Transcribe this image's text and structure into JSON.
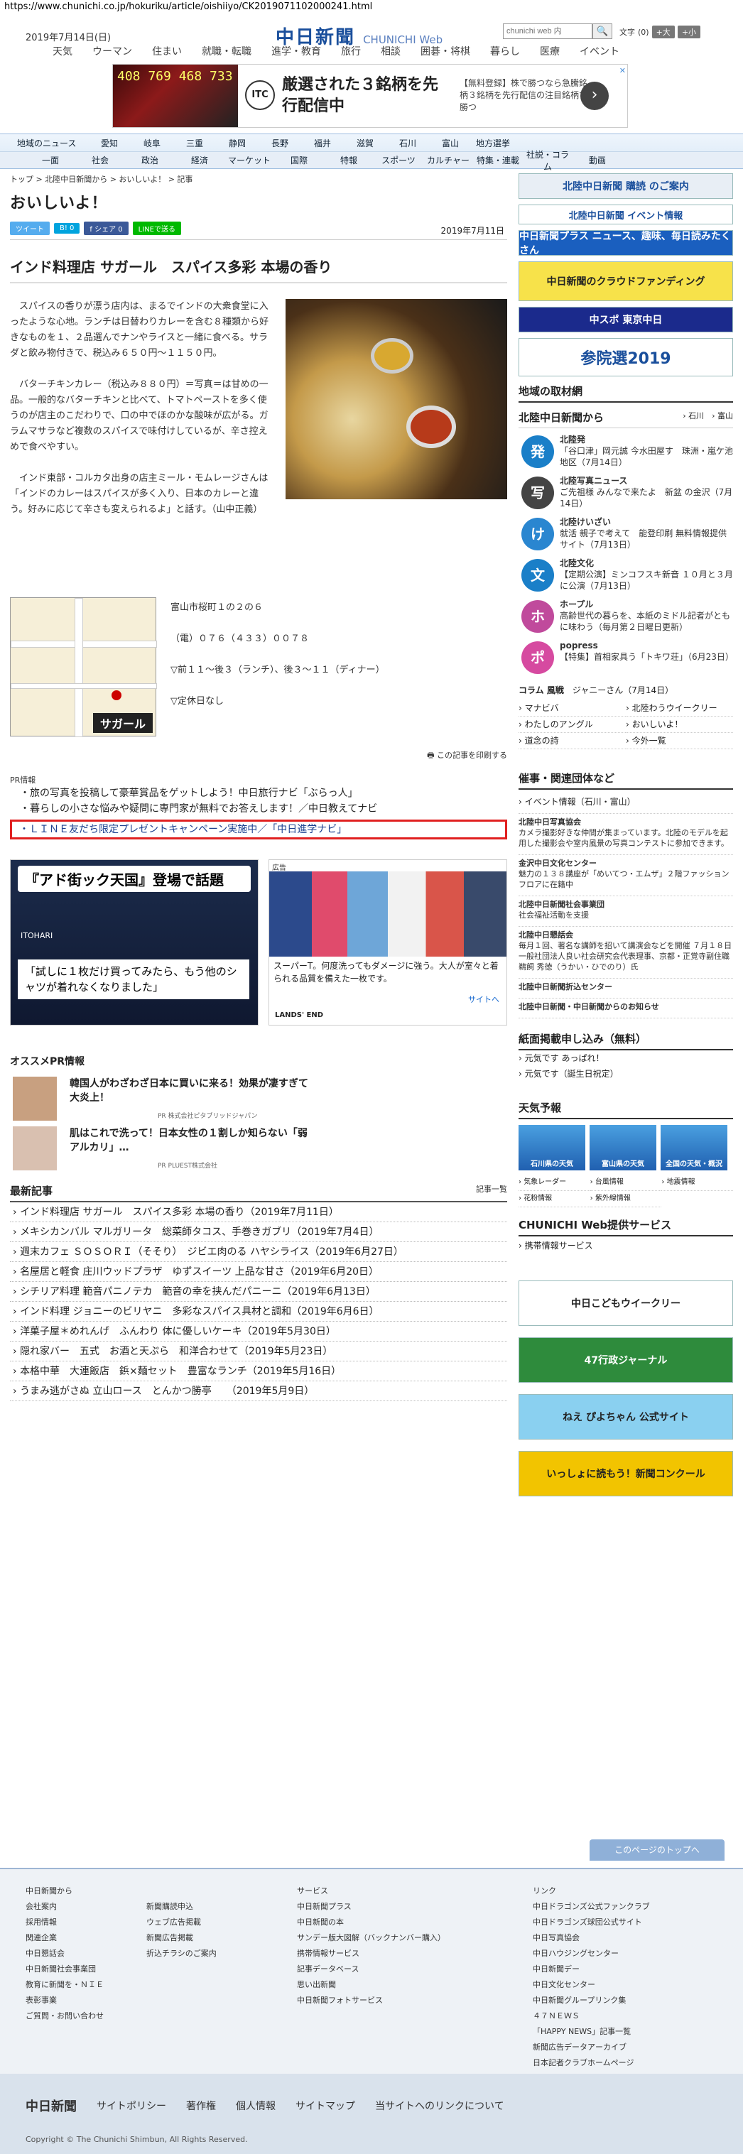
{
  "url": "https://www.chunichi.co.jp/hokuriku/article/oishiiyo/CK2019071102000241.html",
  "header": {
    "date": "2019年7月14日(日)",
    "logo": "中日新聞",
    "logo_sub": "CHUNICHI Web",
    "search_placeholder": "chunichi web 内",
    "font_label": "文字",
    "font_count": "(0)",
    "font_up": "+大",
    "font_down": "+小"
  },
  "gnav": [
    "天気",
    "ウーマン",
    "住まい",
    "就職・転職",
    "進学・教育",
    "旅行",
    "相談",
    "囲碁・将棋",
    "暮らし",
    "医療",
    "イベント"
  ],
  "top_ad": {
    "numbers": "408 769 468 733",
    "brand": "ITC",
    "headline": "厳選された３銘柄を先行配信中",
    "sub": "【無料登録】株で勝つなら急騰銘柄３銘柄を先行配信の注目銘柄で勝つ",
    "close": "✕"
  },
  "region_nav": [
    "地域のニュース",
    "愛知",
    "岐阜",
    "三重",
    "静岡",
    "長野",
    "福井",
    "滋賀",
    "石川",
    "富山",
    "地方選挙"
  ],
  "genre_nav": [
    "一面",
    "社会",
    "政治",
    "経済",
    "マーケット",
    "国際",
    "特報",
    "スポーツ",
    "カルチャー",
    "特集・連載",
    "社説・コラム",
    "動画"
  ],
  "breadcrumb": "トップ > 北陸中日新聞から > おいしいよ！ > 記事",
  "category": "おいしいよ！",
  "share": {
    "tweet": "ツイート",
    "hatena": "B! 0",
    "fb": "f シェア 0",
    "line": "LINEで送る",
    "date": "2019年7月11日"
  },
  "article": {
    "title": "インド料理店 サガール　スパイス多彩 本場の香り",
    "paragraphs": [
      "スパイスの香りが漂う店内は、まるでインドの大衆食堂に入ったような心地。ランチは日替わりカレーを含む８種類から好きなものを１、２品選んでナンやライスと一緒に食べる。サラダと飲み物付きで、税込み６５０円〜１１５０円。",
      "バターチキンカレー（税込み８８０円）＝写真＝は甘めの一品。一般的なバターチキンと比べて、トマトペーストを多く使うのが店主のこだわりで、口の中でほのかな酸味が広がる。ガラムマサラなど複数のスパイスで味付けしているが、辛さ控えめで食べやすい。",
      "インド東部・コルカタ出身の店主ミール・モムレージさんは「インドのカレーはスパイスが多く入り、日本のカレーと違う。好みに応じて辛さも変えられるよ」と話す。（山中正義）"
    ],
    "address": "富山市桜町１の２の６",
    "tel": "（電）０７６（４３３）００７８",
    "hours": "▽前１１〜後３（ランチ）、後３〜１１（ディナー）",
    "holiday": "▽定休日なし",
    "map_label": "サガール",
    "print": "この記事を印刷する"
  },
  "pr": {
    "label": "PR情報",
    "items": [
      "旅の写真を投稿して豪華賞品をゲットしよう！中日旅行ナビ「ぶらっ人」",
      "暮らしの小さな悩みや疑問に専門家が無料でお答えします！／中日教えてナビ",
      "ＬＩＮＥ友だち限定プレゼントキャンペーン実施中／「中日進学ナビ」"
    ]
  },
  "ads": {
    "left_headline": "『アド街ック天国』登場で話題",
    "left_brand": "ITOHARI",
    "left_quote": "「試しに１枚だけ買ってみたら、もう他のシャツが着れなくなりました」",
    "right_text": "スーパーT。何度洗ってもダメージに強う。大人が室々と着られる品質を備えた一枚です。",
    "right_brand": "LANDS' END",
    "right_site": "サイトへ",
    "ad_label": "広告"
  },
  "osusume": {
    "title": "オススメPR情報",
    "items": [
      {
        "text": "韓国人がわざわざ日本に買いに来る！効果が凄すぎて大炎上！",
        "sponsor": "PR 株式会社ピタブリッドジャパン"
      },
      {
        "text": "肌はこれで洗って！日本女性の１割しか知らない「弱アルカリ」…",
        "sponsor": "PR PLUEST株式会社"
      }
    ]
  },
  "latest": {
    "title": "最新記事",
    "more": "記事一覧",
    "items": [
      "インド料理店 サガール　スパイス多彩 本場の香り（2019年7月11日）",
      "メキシカンバル マルガリータ　総菜師タコス、手巻きガブリ（2019年7月4日）",
      "週末カフェ ＳＯＳＯＲＩ（そそり）　ジビエ肉のる ハヤシライス（2019年6月27日）",
      "名屋居と軽食 庄川ウッドプラザ　ゆずスイーツ 上品な甘さ（2019年6月20日）",
      "シチリア料理 範音パニノテカ　範音の幸を挟んだパニーニ（2019年6月13日）",
      "インド料理 ジョニーのビリヤニ　多彩なスパイス具材と調和（2019年6月6日）",
      "洋菓子屋＊めれんげ　ふんわり 体に優しいケーキ（2019年5月30日）",
      "隠れ家バー　五式　お酒と天ぷら　和洋合わせて（2019年5月23日）",
      "本格中華　大連飯店　鋲×麺セット　豊富なランチ（2019年5月16日）",
      "うまみ逃がさぬ 立山ロース　とんかつ勝亭　　（2019年5月9日）"
    ]
  },
  "right": {
    "subscribe": "北陸中日新聞 購読 のご案内",
    "events": "北陸中日新聞 イベント情報",
    "banners": [
      "中日新聞プラス ニュース、趣味、毎日読みたくさん",
      "中日新聞のクラウドファンディング",
      "中スポ 東京中日",
      "参院選2019"
    ],
    "local_title": "地域の取材網",
    "from_title": "北陸中日新聞から",
    "from_links": [
      "石川",
      "富山"
    ],
    "items": [
      {
        "icon": "発",
        "color": "#1a7fc8",
        "cat": "北陸発",
        "text": "「谷口津」岡元誠 今水田屋す　珠洲・嵐ケ池地区（7月14日）"
      },
      {
        "icon": "写",
        "color": "#444",
        "cat": "北陸写真ニュース",
        "text": "ご先祖様 みんなで来たよ　新盆 の金沢（7月14日）"
      },
      {
        "icon": "け",
        "color": "#2a86d0",
        "cat": "北陸けいざい",
        "text": "就活 親子で考えて　能登印刷 無料情報提供サイト（7月13日）"
      },
      {
        "icon": "文",
        "color": "#1a7fc8",
        "cat": "北陸文化",
        "text": "【定期公演】ミンコフスキ新音 １０月と３月に公演（7月13日）"
      },
      {
        "icon": "ホ",
        "color": "#c04a9c",
        "cat": "ホープル",
        "text": "高齢世代の暮らを、本紙のミドル記者がともに味わう（毎月第２日曜日更新）"
      },
      {
        "icon": "ポ",
        "color": "#d64aa0",
        "cat": "popress",
        "text": "【特集】首相家具う「トキワ荘」（6月23日）"
      }
    ],
    "column_label": "コラム 風戦",
    "column_text": "ジャニーさん（7月14日）",
    "grid": [
      "マナビバ",
      "北陸わうウイークリー",
      "わたしのアングル",
      "おいしいよ！",
      "道念の詩",
      "今外一覧"
    ],
    "org_title": "催事・関連団体など",
    "org_events": "イベント情報（石川・富山）",
    "orgs": [
      {
        "name": "北陸中日写真協会",
        "text": "カメラ撮影好きな仲間が集まっています。北陸のモデルを起用した撮影会や室内風景の写真コンテストに参加できます。"
      },
      {
        "name": "金沢中日文化センター",
        "text": "魅力の１３８講座が「めいてつ・エムザ」２階ファッションフロアに在籍中"
      },
      {
        "name": "北陸中日新聞社会事業団",
        "text": "社会福祉活動を支援"
      },
      {
        "name": "北陸中日懇話会",
        "text": "毎月１回、著名な講師を招いて講演会などを開催 ７月１８日 一般社団法人良い社会研究会代表理事、京都・正覚寺副住職 鵜飼 秀徳（うかい・ひでのり）氏"
      },
      {
        "name": "北陸中日新聞折込センター",
        "text": ""
      },
      {
        "name": "北陸中日新聞・中日新聞からのお知らせ",
        "text": ""
      }
    ],
    "apply_title": "紙面掲載申し込み（無料）",
    "apply_items": [
      "元気です あっぱれ！",
      "元気です（誕生日祝定）"
    ],
    "weather_title": "天気予報",
    "weather": [
      "石川県の天気",
      "富山県の天気",
      "全国の天気・概況"
    ],
    "warn": [
      "気象レーダー",
      "台風情報",
      "地震情報",
      "花粉情報",
      "紫外線情報"
    ],
    "service_title": "CHUNICHI Web提供サービス",
    "service": "携帯情報サービス",
    "promo": [
      "中日こどもウイークリー",
      "47行政ジャーナル",
      "ねえ ぴよちゃん 公式サイト",
      "いっしょに読もう！新聞コンクール"
    ]
  },
  "to_top": "このページのトップへ",
  "footer": {
    "c1": [
      "中日新聞から",
      "会社案内",
      "採用情報",
      "関連企業",
      "中日懇話会",
      "中日新聞社会事業団",
      "教育に新聞を・ＮＩＥ",
      "表彰事業",
      "ご質問・お問い合わせ"
    ],
    "c2": [
      "新聞購読申込",
      "ウェブ広告掲載",
      "新聞広告掲載",
      "折込チラシのご案内"
    ],
    "c3": [
      "サービス",
      "中日新聞プラス",
      "中日新聞の本",
      "サンデー版大図解（バックナンバー購入）",
      "携帯情報サービス",
      "記事データベース",
      "思い出新聞",
      "中日新聞フォトサービス"
    ],
    "c4": [
      "リンク",
      "中日ドラゴンズ公式ファンクラブ",
      "中日ドラゴンズ球団公式サイト",
      "中日写真協会",
      "中日ハウジングセンター",
      "中日新聞デー",
      "中日文化センター",
      "中日新聞グループリンク集",
      "４７ＮＥＷＳ",
      "「HAPPY NEWS」記事一覧",
      "新聞広告データアーカイブ",
      "日本記者クラブホームページ"
    ],
    "nav": [
      "中日新聞",
      "サイトポリシー",
      "著作権",
      "個人情報",
      "サイトマップ",
      "当サイトへのリンクについて"
    ],
    "copy": "Copyright © The Chunichi Shimbun, All Rights Reserved."
  }
}
